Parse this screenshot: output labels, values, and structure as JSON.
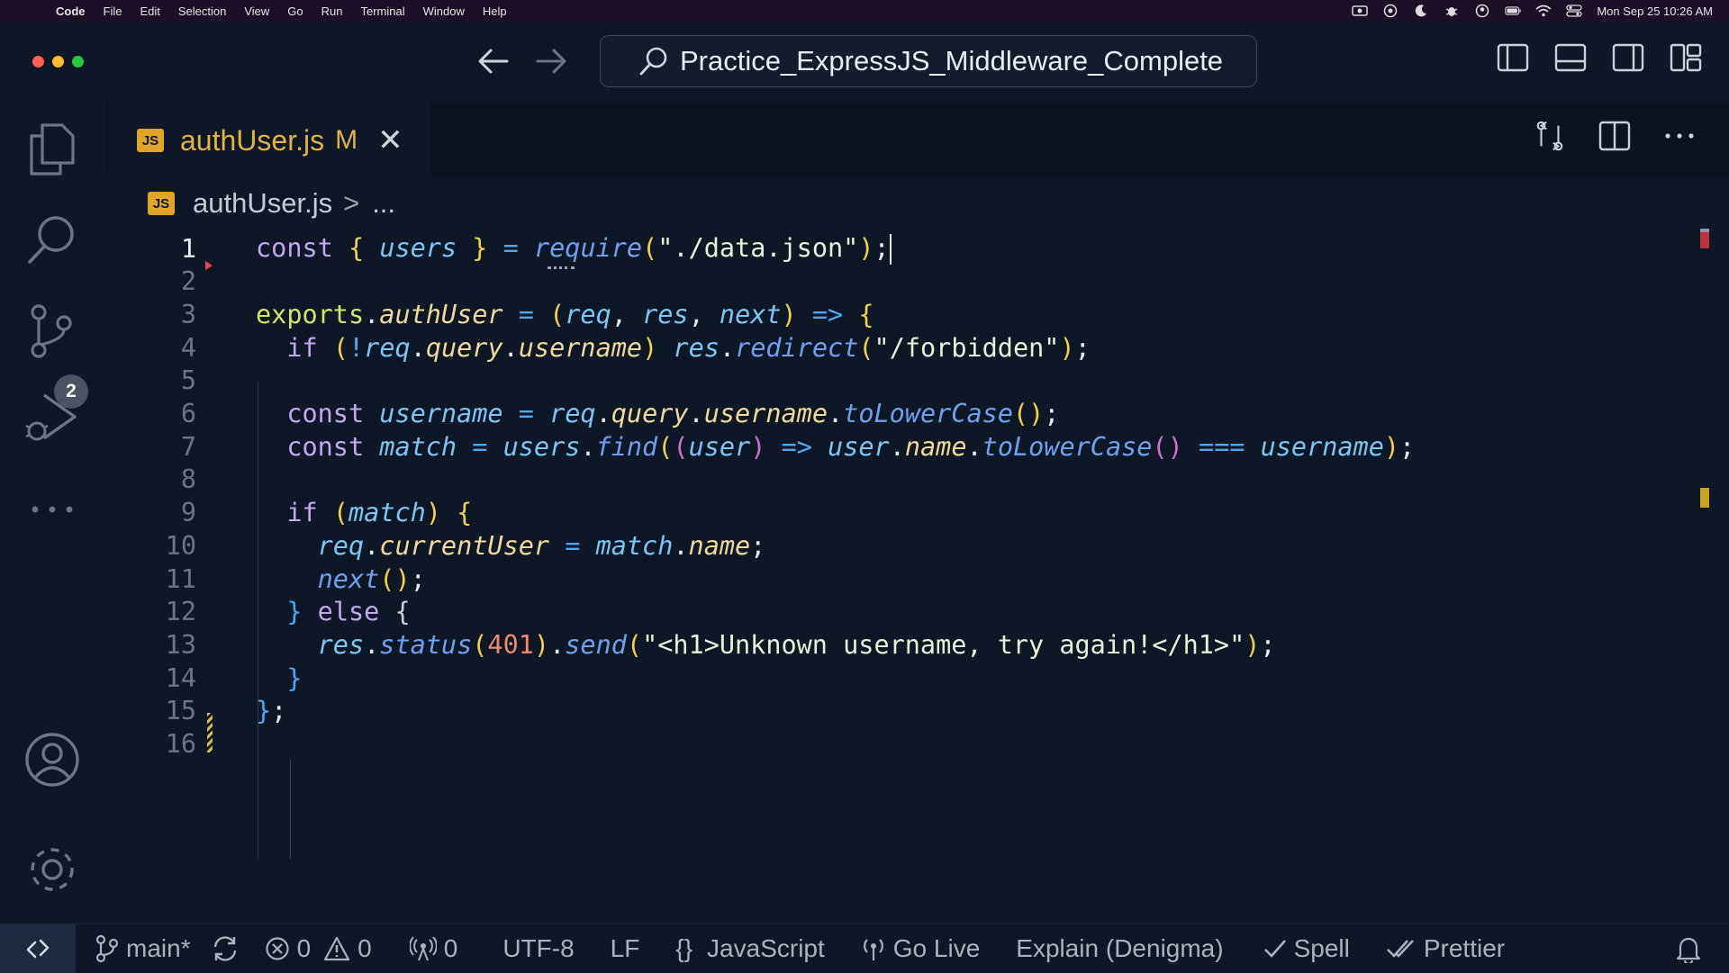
{
  "menubar": {
    "app": "Code",
    "items": [
      "File",
      "Edit",
      "Selection",
      "View",
      "Go",
      "Run",
      "Terminal",
      "Window",
      "Help"
    ],
    "clock": "Mon Sep 25  10:26 AM"
  },
  "titlebar": {
    "search_text": "Practice_ExpressJS_Middleware_Complete"
  },
  "activity_bar": {
    "source_control_badge": "2"
  },
  "tab": {
    "badge": "JS",
    "filename": "authUser.js",
    "status": "M",
    "close": "✕"
  },
  "breadcrumb": {
    "badge": "JS",
    "file": "authUser.js",
    "separator": ">",
    "more": "..."
  },
  "editor": {
    "language": "javascript",
    "active_line": 1,
    "lines": [
      "const { users } = require(\"./data.json\");",
      "",
      "exports.authUser = (req, res, next) => {",
      "  if (!req.query.username) res.redirect(\"/forbidden\");",
      "",
      "  const username = req.query.username.toLowerCase();",
      "  const match = users.find((user) => user.name.toLowerCase() === username);",
      "",
      "  if (match) {",
      "    req.currentUser = match.name;",
      "    next();",
      "  } else {",
      "    res.status(401).send(\"<h1>Unknown username, try again!</h1>\");",
      "  }",
      "};",
      ""
    ]
  },
  "statusbar": {
    "branch": "main*",
    "errors": "0",
    "warnings": "0",
    "ports": "0",
    "encoding": "UTF-8",
    "eol": "LF",
    "language_icon": "{}",
    "language": "JavaScript",
    "golive": "Go Live",
    "explain": "Explain (Denigma)",
    "spell": "Spell",
    "prettier": "Prettier"
  },
  "colors": {
    "background": "#0e1726",
    "accent_js": "#e0a526",
    "modified": "#e0b24a",
    "keyword": "#c5a7f0",
    "function": "#6fa0f0",
    "variable": "#7cc5f5"
  }
}
